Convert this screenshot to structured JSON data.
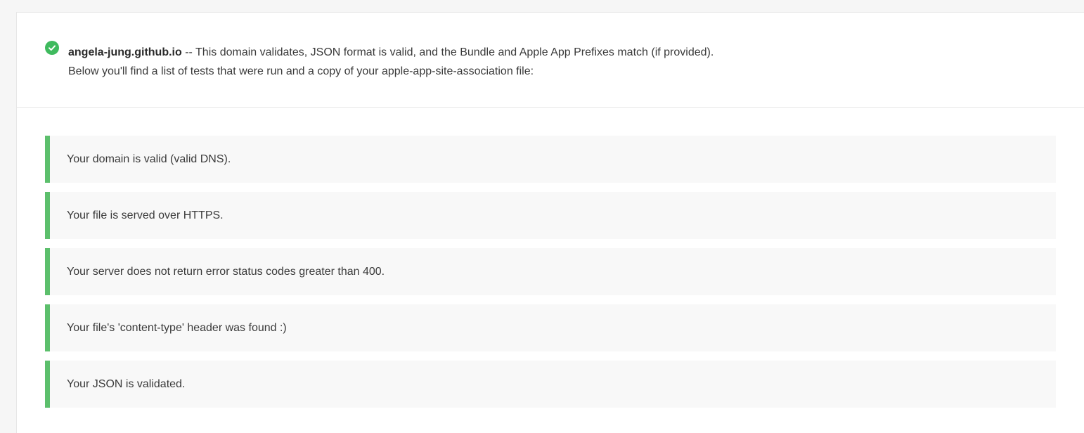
{
  "summary": {
    "domain": "angela-jung.github.io",
    "message": " -- This domain validates, JSON format is valid, and the Bundle and Apple App Prefixes match (if provided).",
    "subtext": "Below you'll find a list of tests that were run and a copy of your apple-app-site-association file:",
    "status_icon": "check-circle-icon"
  },
  "tests": [
    {
      "label": "Your domain is valid (valid DNS)."
    },
    {
      "label": "Your file is served over HTTPS."
    },
    {
      "label": "Your server does not return error status codes greater than 400."
    },
    {
      "label": "Your file's 'content-type' header was found :)"
    },
    {
      "label": "Your JSON is validated."
    }
  ],
  "colors": {
    "success": "#3fba5e",
    "test_border": "#5cbf6c",
    "test_bg": "#f8f8f8"
  }
}
